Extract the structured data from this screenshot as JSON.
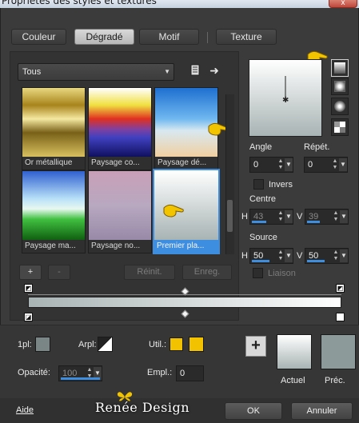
{
  "window": {
    "title": "Propriétés des styles et textures",
    "close_label": "x"
  },
  "tabs": [
    {
      "label": "Couleur",
      "active": false
    },
    {
      "label": "Dégradé",
      "active": true
    },
    {
      "label": "Motif",
      "active": false
    },
    {
      "label": "Texture",
      "active": false
    }
  ],
  "library": {
    "category": "Tous",
    "gradients": [
      {
        "label": "Or métallique",
        "colors": [
          "#e8d880",
          "#a8841c",
          "#f4e8a0",
          "#786018",
          "#d8c060"
        ]
      },
      {
        "label": "Paysage co...",
        "colors": [
          "#ffffff",
          "#f0e040",
          "#e03020",
          "#4040c0",
          "#101060"
        ]
      },
      {
        "label": "Paysage dé...",
        "colors": [
          "#1e6fd0",
          "#70b8f0",
          "#d8e8f0",
          "#f0d0a0"
        ]
      },
      {
        "label": "Paysage ma...",
        "colors": [
          "#3060d0",
          "#b8e0f8",
          "#40c040",
          "#106010"
        ]
      },
      {
        "label": "Paysage no...",
        "colors": [
          "#c8a0b8",
          "#b0a0c0",
          "#988aa8"
        ]
      },
      {
        "label": "Premier pla...",
        "colors": [
          "#ffffff",
          "#a8b3b3"
        ],
        "selected": true
      }
    ],
    "add_label": "+",
    "remove_label": "-",
    "reset_label": "Réinit.",
    "save_label": "Enreg."
  },
  "properties": {
    "angle_label": "Angle",
    "angle_value": "0",
    "repeat_label": "Répét.",
    "repeat_value": "0",
    "invert_label": "Invers",
    "center_label": "Centre",
    "center_h_label": "H",
    "center_h_value": "43",
    "center_v_label": "V",
    "center_v_value": "39",
    "source_label": "Source",
    "source_h_label": "H",
    "source_h_value": "50",
    "source_v_label": "V",
    "source_v_value": "50",
    "link_label": "Liaison"
  },
  "gradient_editor": {
    "start_color": "#a8b3b3",
    "end_color": "#ffffff"
  },
  "bottom": {
    "fg_label": "1pl:",
    "arpl_label": "Arpl:",
    "util_label": "Util.:",
    "opacity_label": "Opacité:",
    "opacity_value": "100",
    "empl_label": "Empl.:",
    "empl_value": "0",
    "current_label": "Actuel",
    "previous_label": "Préc.",
    "util_color_1": "#f2c200",
    "util_color_2": "#f2c200",
    "current_color_top": "#ffffff",
    "current_color_bottom": "#a8b3b3",
    "previous_color": "#8c9a9a",
    "plus_label": "+"
  },
  "footer": {
    "help_label": "Aide",
    "ok_label": "OK",
    "cancel_label": "Annuler",
    "watermark": "Renée Design"
  }
}
